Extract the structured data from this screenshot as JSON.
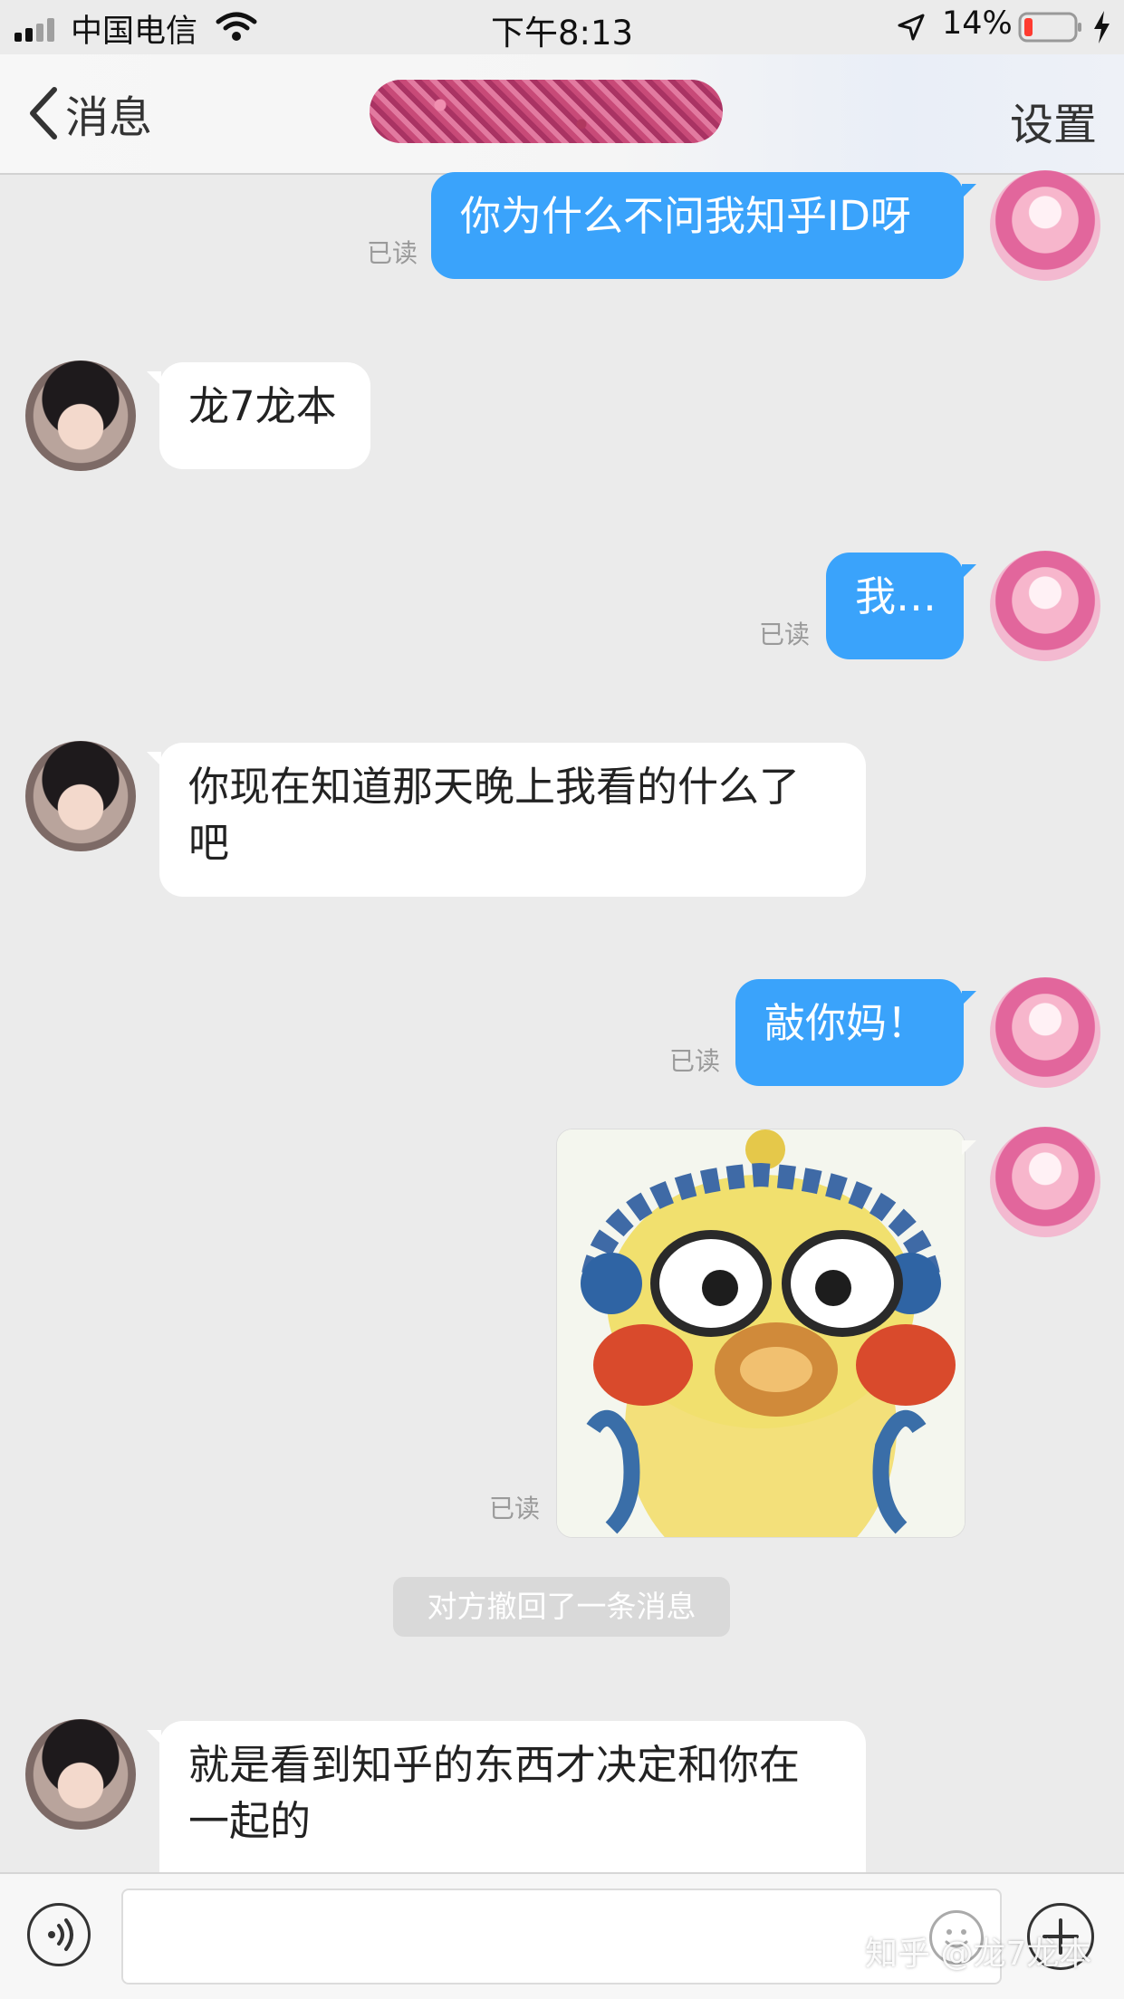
{
  "status_bar": {
    "carrier": "中国电信",
    "time": "下午8:13",
    "battery_percent": "14%",
    "icons": [
      "signal-icon",
      "wifi-icon",
      "location-arrow-icon",
      "battery-low-icon",
      "charging-bolt-icon"
    ]
  },
  "header": {
    "back_label": "消息",
    "settings_label": "设置",
    "title_redacted": true
  },
  "colors": {
    "sent_bubble": "#3aa3fb",
    "received_bubble": "#ffffff",
    "chat_background": "#ebebeb",
    "read_receipt": "#9a9a9a"
  },
  "messages": [
    {
      "from": "me",
      "type": "text",
      "text": "你为什么不问我知乎ID呀",
      "receipt": "已读"
    },
    {
      "from": "her",
      "type": "text",
      "text": "龙7龙本"
    },
    {
      "from": "me",
      "type": "text",
      "text": "我…",
      "receipt": "已读"
    },
    {
      "from": "her",
      "type": "text",
      "text": "你现在知道那天晚上我看的什么了\n吧"
    },
    {
      "from": "me",
      "type": "text",
      "text": "敲你妈！",
      "receipt": "已读"
    },
    {
      "from": "me",
      "type": "sticker",
      "sticker": "yellow-duck-sticker",
      "receipt": "已读"
    },
    {
      "type": "system",
      "text": "对方撤回了一条消息"
    },
    {
      "from": "her",
      "type": "text",
      "text": "就是看到知乎的东西才决定和你在\n一起的"
    }
  ],
  "input_bar": {
    "placeholder": "",
    "icons": [
      "voice-icon",
      "emoji-icon",
      "plus-icon"
    ]
  },
  "watermark": "知乎 @龙7龙本"
}
